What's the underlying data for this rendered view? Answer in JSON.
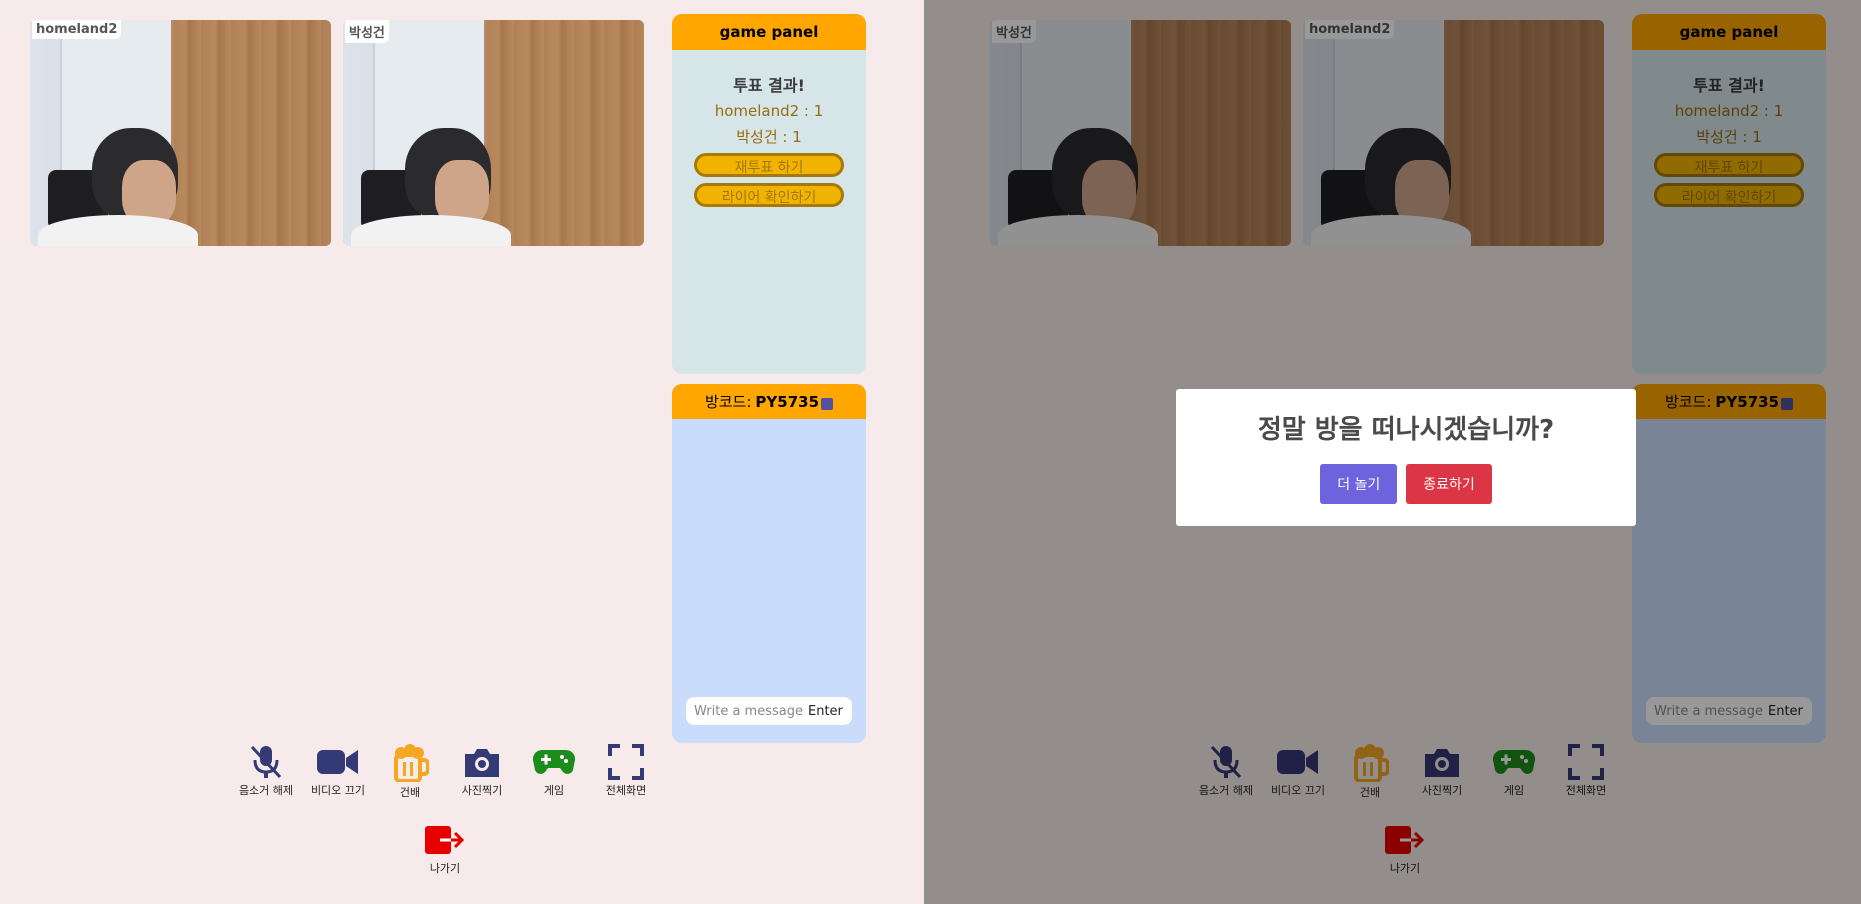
{
  "left": {
    "videos": [
      {
        "name": "homeland2"
      },
      {
        "name": "박성건"
      }
    ]
  },
  "right": {
    "videos": [
      {
        "name": "박성건"
      },
      {
        "name": "homeland2"
      }
    ]
  },
  "game_panel": {
    "title": "game panel",
    "vote_title": "투표 결과!",
    "results": [
      "homeland2 : 1",
      "박성건 : 1"
    ],
    "revote_button": "재투표 하기",
    "check_liar_button": "라이어 확인하기"
  },
  "chat": {
    "room_code_label": "방코드:",
    "room_code": "PY5735",
    "placeholder": "Write a message",
    "enter_label": "Enter"
  },
  "controls": {
    "mute": "음소거 해제",
    "video": "비디오 끄기",
    "cheers": "건배",
    "photo": "사진찍기",
    "game": "게임",
    "fullscreen": "전체화면",
    "exit": "나가기"
  },
  "modal": {
    "question": "정말 방을 떠나시겠습니까?",
    "stay_button": "더 놀기",
    "quit_button": "종료하기"
  },
  "colors": {
    "panel_header": "#ffa600",
    "game_panel_bg": "#d5e5e8",
    "chat_bg": "#cadcfc",
    "stay_button": "#6c63dd",
    "quit_button": "#dc3545",
    "icon_navy": "#343a75",
    "icon_orange": "#f5a623",
    "icon_green": "#1c8c1c",
    "icon_red": "#e60000"
  }
}
